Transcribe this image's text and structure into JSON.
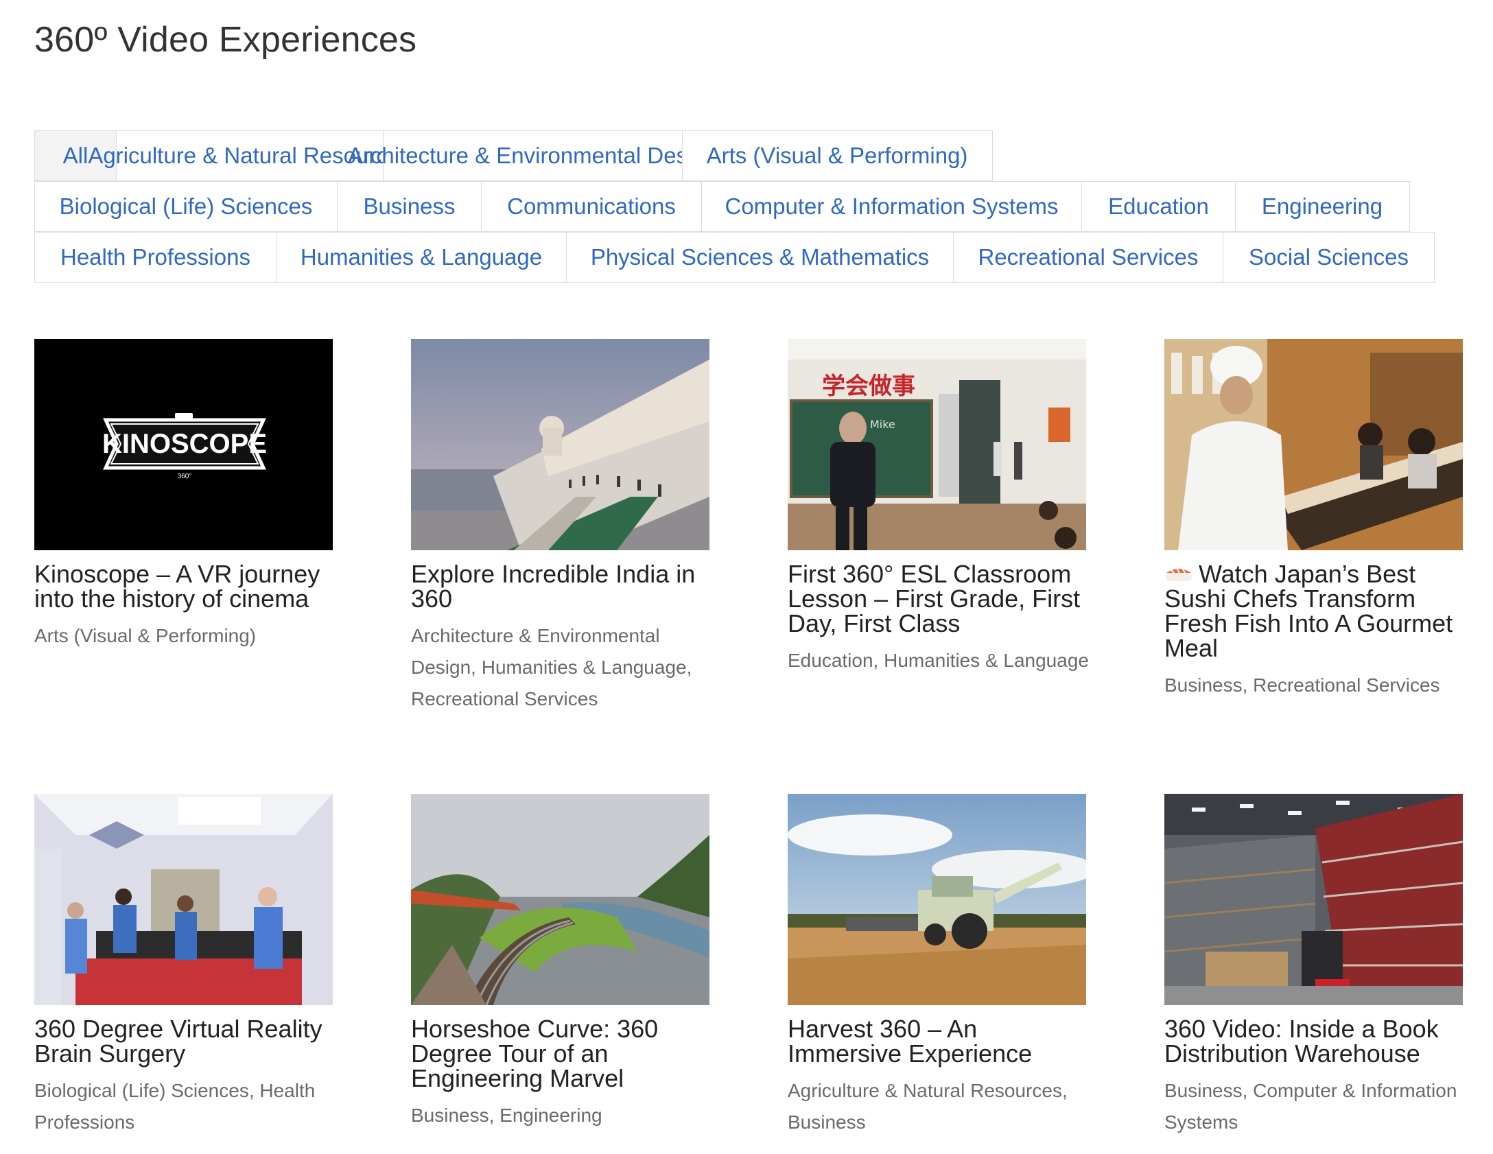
{
  "page": {
    "title": "360º Video Experiences"
  },
  "filters": {
    "row1": [
      "All",
      "Agriculture & Natural Resources",
      "Architecture & Environmental Design",
      "Arts (Visual & Performing)"
    ],
    "row2": [
      "Biological (Life) Sciences",
      "Business",
      "Communications",
      "Computer & Information Systems",
      "Education",
      "Engineering"
    ],
    "row3": [
      "Health Professions",
      "Humanities & Language",
      "Physical Sciences & Mathematics",
      "Recreational Services",
      "Social Sciences"
    ],
    "active": "All"
  },
  "videos": [
    {
      "title": "Kinoscope – A VR journey into the history of cinema",
      "tags": "Arts (Visual & Performing)",
      "thumb_icon": "kinoscope-logo",
      "logo_text": "KINOSCOPE",
      "logo_sub": "360°"
    },
    {
      "title": "Explore Incredible India in 360",
      "tags": "Architecture & Environmental Design, Humanities & Language, Recreational Services",
      "thumb_icon": "palace-waterfront"
    },
    {
      "title": "First 360° ESL Classroom Lesson – First Grade, First Day, First Class",
      "tags": "Education, Humanities & Language",
      "thumb_icon": "classroom",
      "board_text": "Mike",
      "banner_text": "学会做事"
    },
    {
      "title": "Watch Japan’s Best Sushi Chefs Transform Fresh Fish Into A Gourmet Meal",
      "tags": "Business, Recreational Services",
      "thumb_icon": "sushi-chef",
      "title_emoji": "sushi-emoji"
    },
    {
      "title": "360 Degree Virtual Reality Brain Surgery",
      "tags": "Biological (Life) Sciences, Health Professions",
      "thumb_icon": "operating-room"
    },
    {
      "title": "Horseshoe Curve: 360 Degree Tour of an Engineering Marvel",
      "tags": "Business, Engineering",
      "thumb_icon": "railroad-curve"
    },
    {
      "title": "Harvest 360 – An Immersive Experience",
      "tags": "Agriculture & Natural Resources, Business",
      "thumb_icon": "combine-harvester"
    },
    {
      "title": "360 Video: Inside a Book Distribution Warehouse",
      "tags": "Business, Computer & Information Systems",
      "thumb_icon": "warehouse"
    }
  ]
}
